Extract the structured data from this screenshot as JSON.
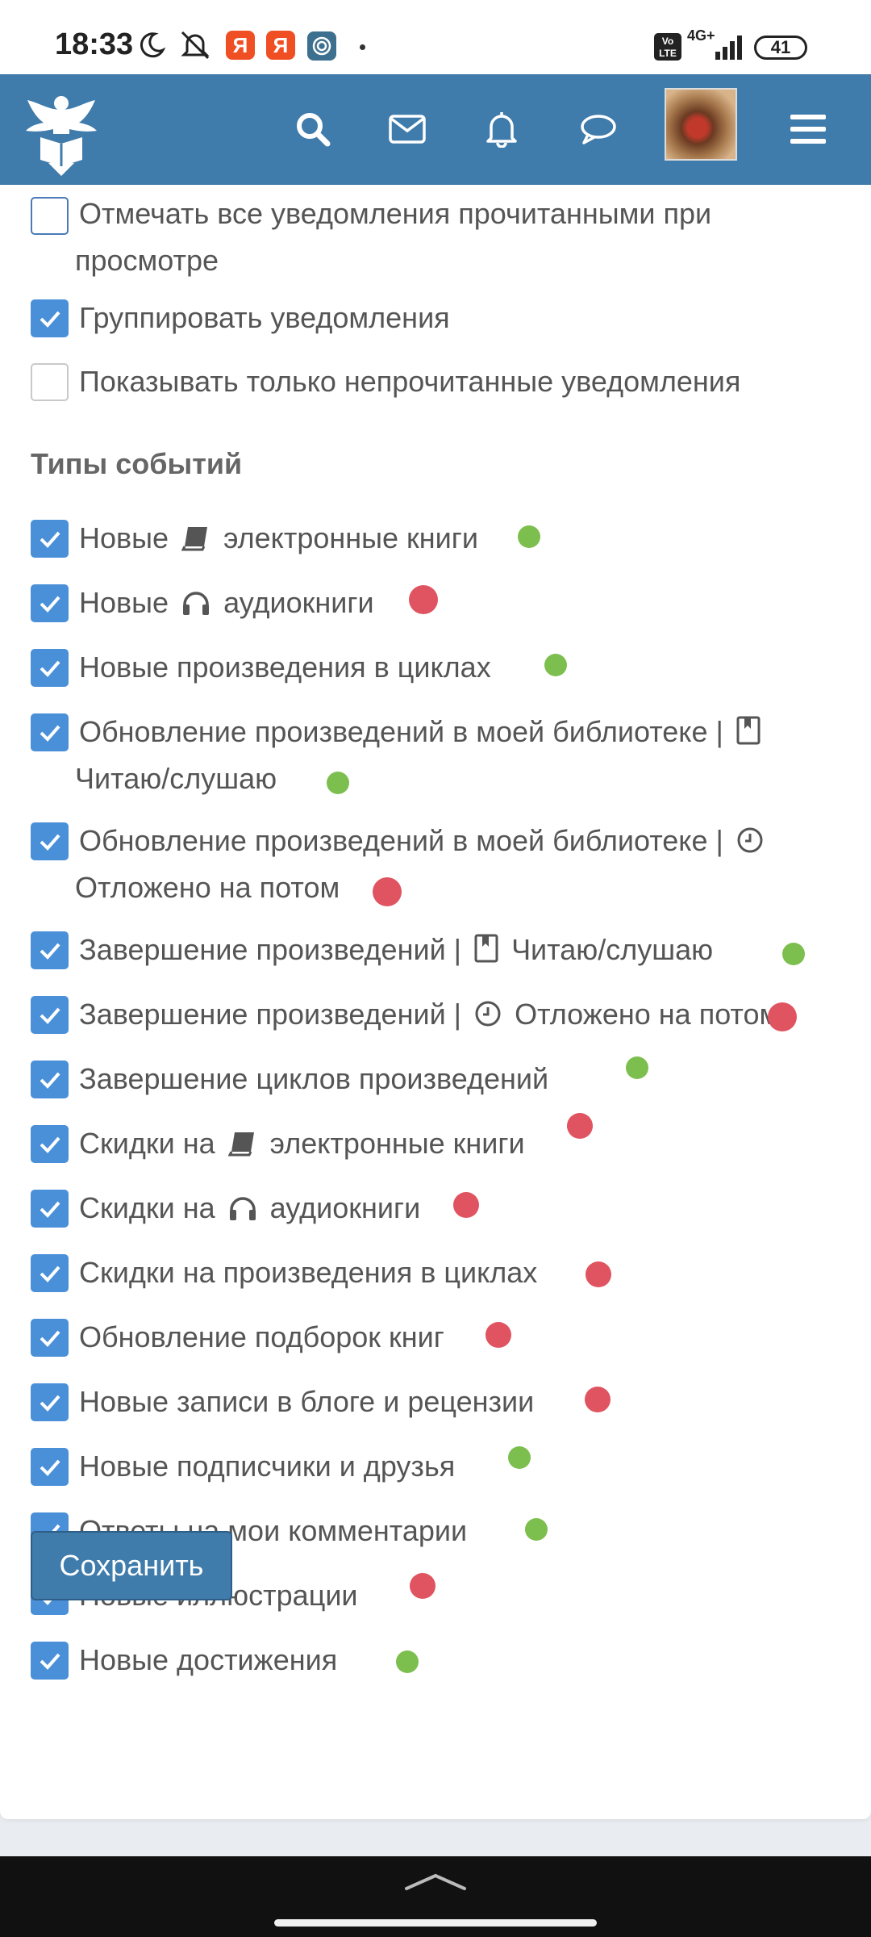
{
  "status_bar": {
    "time": "18:33",
    "ya_badge_1": "Я",
    "ya_badge_2": "Я",
    "network_top": "4G+",
    "volte": "Vo LTE",
    "battery": "41"
  },
  "header": {
    "icons": [
      "eagle-book-logo",
      "search-icon",
      "mail-icon",
      "bell-icon",
      "chat-bubble-icon",
      "avatar",
      "menu-icon"
    ]
  },
  "settings": {
    "options": [
      {
        "label_line1": "Отмечать все уведомления прочитанными при",
        "label_line2": "просмотре",
        "checked": false
      },
      {
        "label": "Группировать уведомления",
        "checked": true
      },
      {
        "label": "Показывать только непрочитанные уведомления",
        "checked": false
      }
    ],
    "section_title": "Типы событий",
    "event_types": [
      {
        "pre": "Новые",
        "icon": "book-icon",
        "post": "электронные книги",
        "status": "green"
      },
      {
        "pre": "Новые",
        "icon": "headphones-icon",
        "post": "аудиокниги",
        "status": "red"
      },
      {
        "label": "Новые произведения в циклах",
        "status": "green"
      },
      {
        "line1": "Обновление произведений в моей библиотеке |",
        "icon": "bookmark-icon",
        "line2": "Читаю/слушаю",
        "status": "green"
      },
      {
        "line1": "Обновление произведений в моей библиотеке |",
        "icon": "clock-icon",
        "line2": "Отложено на потом",
        "status": "red"
      },
      {
        "pre": "Завершение произведений |",
        "icon": "bookmark-icon",
        "post": "Читаю/слушаю",
        "status": "green"
      },
      {
        "pre": "Завершение произведений |",
        "icon": "clock-icon",
        "post": "Отложено на потом",
        "status": "red"
      },
      {
        "label": "Завершение циклов произведений",
        "status": "green"
      },
      {
        "pre": "Скидки на",
        "icon": "book-icon",
        "post": "электронные книги",
        "status": "red"
      },
      {
        "pre": "Скидки на",
        "icon": "headphones-icon",
        "post": "аудиокниги",
        "status": "red"
      },
      {
        "label": "Скидки на произведения в циклах",
        "status": "red"
      },
      {
        "label": "Обновление подборок книг",
        "status": "red"
      },
      {
        "label": "Новые записи в блоге и рецензии",
        "status": "red"
      },
      {
        "label": "Новые подписчики и друзья",
        "status": "green"
      },
      {
        "label": "Ответы на мои комментарии",
        "status": "green"
      },
      {
        "label": "Новые иллюстрации",
        "status": "red"
      },
      {
        "label": "Новые достижения",
        "status": "green"
      }
    ],
    "save_label": "Сохранить"
  },
  "colors": {
    "header_bg": "#3f7bab",
    "checkbox_checked": "#4a90d9",
    "dot_green": "#7cbf4e",
    "dot_red": "#e05360"
  }
}
